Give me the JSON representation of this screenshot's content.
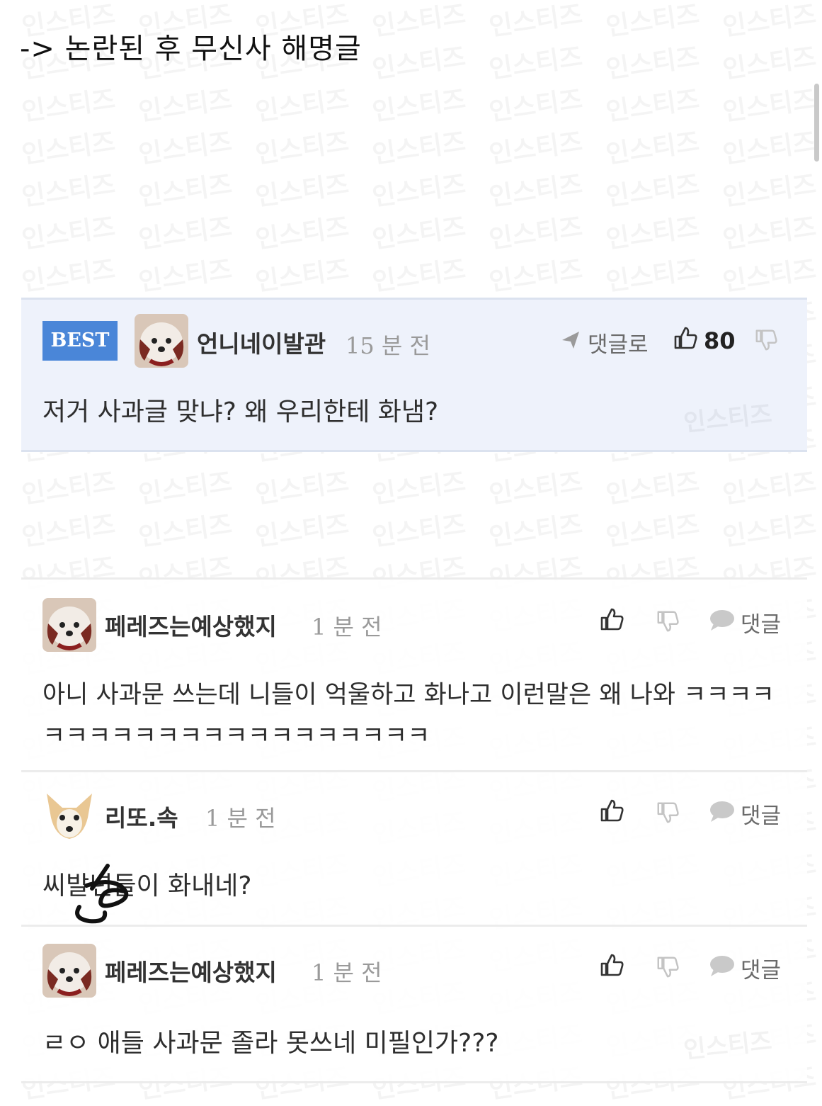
{
  "title": "-> 논란된 후 무신사 해명글",
  "watermark": "인스티즈",
  "best_comment": {
    "badge": "BEST",
    "nickname": "언니네이발관",
    "time": "15 분 전",
    "reply_label": "댓글로",
    "like_count": "80",
    "text": "저거 사과글 맞냐? 왜 우리한테 화냄?"
  },
  "comments": [
    {
      "nickname": "페레즈는예상했지",
      "time": "1 분 전",
      "reply_label": "댓글",
      "text": "아니 사과문 쓰는데 니들이 억울하고 화나고 이런말은 왜 나와 ㅋㅋㅋㅋㅋㅋㅋㅋㅋㅋㅋㅋㅋㅋㅋㅋㅋㅋㅋㅋㅋ",
      "avatar": "puppy-icon"
    },
    {
      "nickname": "리또.속",
      "time": "1 분 전",
      "reply_label": "댓글",
      "text": "씨발년들이 화내네?",
      "avatar": "fox-dog-icon"
    },
    {
      "nickname": "페레즈는예상했지",
      "time": "1 분 전",
      "reply_label": "댓글",
      "text": "ㄹㅇ 애들 사과문 졸라 못쓰네 미필인가???",
      "avatar": "puppy-icon"
    }
  ],
  "colors": {
    "best_bg": "#eef2fb",
    "badge": "#4a86d8",
    "meta_gray": "#9a9a9a"
  }
}
